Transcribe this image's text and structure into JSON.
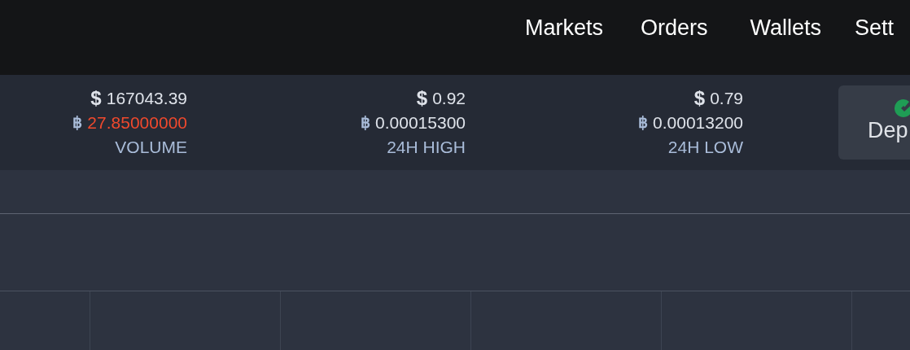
{
  "nav": {
    "items": [
      {
        "label": "Markets"
      },
      {
        "label": "Orders"
      },
      {
        "label": "Wallets"
      },
      {
        "label": "Sett"
      }
    ]
  },
  "stats": [
    {
      "usd_symbol": "$",
      "usd": "167043.39",
      "btc_symbol": "฿",
      "btc": "27.85000000",
      "highlighted": true,
      "label": "VOLUME"
    },
    {
      "usd_symbol": "$",
      "usd": "0.92",
      "btc_symbol": "฿",
      "btc": "0.00015300",
      "highlighted": false,
      "label": "24H HIGH"
    },
    {
      "usd_symbol": "$",
      "usd": "0.79",
      "btc_symbol": "฿",
      "btc": "0.00013200",
      "highlighted": false,
      "label": "24H LOW"
    }
  ],
  "deposit_button": {
    "label": "Dep"
  }
}
